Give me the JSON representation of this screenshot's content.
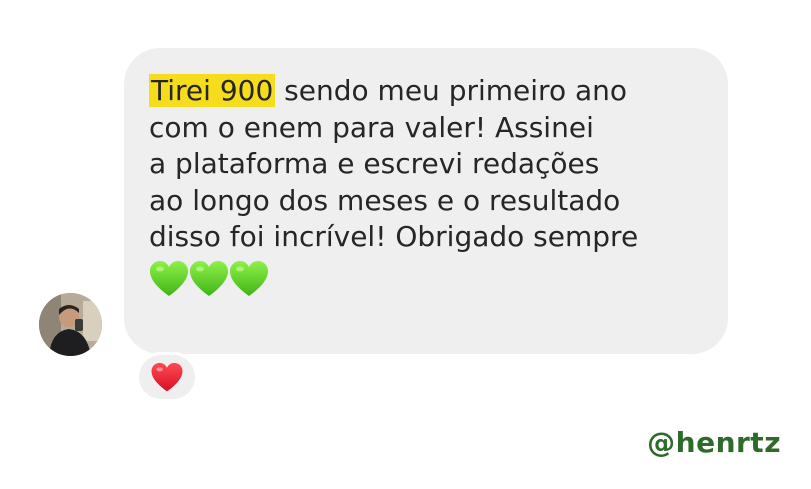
{
  "message": {
    "highlight": "Tirei 900",
    "line1_rest": " sendo meu primeiro ano",
    "line2": "com o enem para valer! Assinei",
    "line3": "a plataforma e escrevi redações",
    "line4": "ao longo dos meses e o resultado",
    "line5": "disso foi incrível! Obrigado sempre",
    "emoji_icons": [
      "green-heart-icon",
      "green-heart-icon",
      "green-heart-icon"
    ]
  },
  "reaction": {
    "icon": "red-heart-icon"
  },
  "watermark": {
    "handle": "@henrtz"
  },
  "colors": {
    "bubble": "#efefef",
    "highlight": "#f5dc1c",
    "green_heart": "#62d12b",
    "red_heart": "#e8152a",
    "handle": "#2e6a2a"
  }
}
